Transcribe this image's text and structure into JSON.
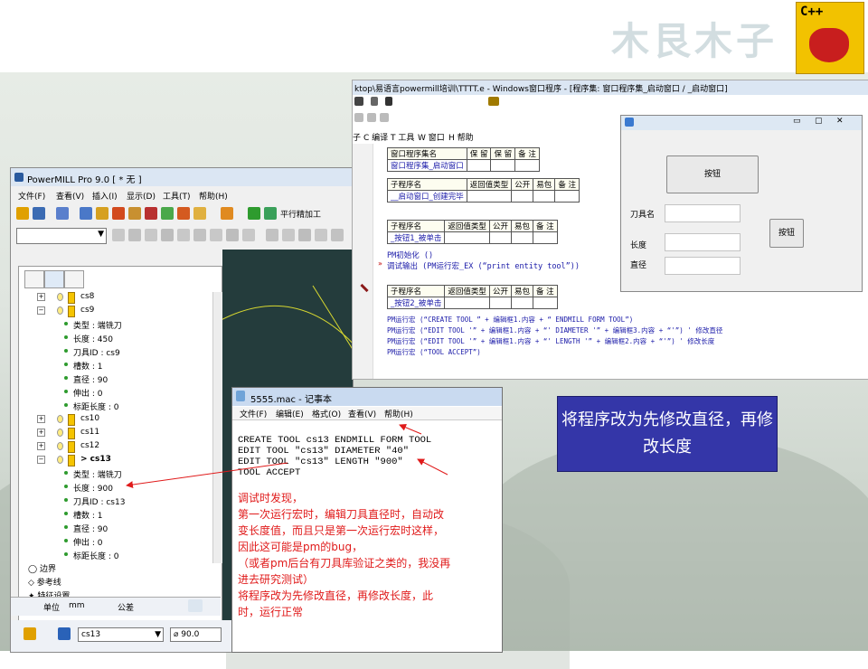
{
  "brand": {
    "watermark": "木艮木子",
    "logo_text": "C++"
  },
  "powermill": {
    "title": "PowerMILL Pro 9.0   [ * 无 ]",
    "menu": [
      "文件(F)",
      "查看(V)",
      "插入(I)",
      "显示(D)",
      "工具(T)",
      "帮助(H)"
    ],
    "toolbar_label": "平行精加工",
    "tree": {
      "collapsed_tools": [
        "cs8",
        "cs9"
      ],
      "cs9_props": [
        "类型 : 端铣刀",
        "长度 : 450",
        "刀具ID : cs9",
        "槽数 : 1",
        "直径 : 90",
        "伸出 : 0",
        "标距长度 : 0"
      ],
      "more_tools": [
        "cs10",
        "cs11",
        "cs12",
        "> cs13"
      ],
      "cs13_props": [
        "类型 : 端铣刀",
        "长度 : 900",
        "刀具ID : cs13",
        "槽数 : 1",
        "直径 : 90",
        "伸出 : 0",
        "标距长度 : 0"
      ],
      "nodes": [
        "边界",
        "参考线",
        "特征设置"
      ]
    },
    "status": {
      "unit_label": "单位",
      "unit_value": "mm",
      "tol_label": "公差"
    },
    "bottom": {
      "tool_select": "cs13",
      "diameter": "90.0"
    }
  },
  "notepad": {
    "title": "5555.mac - 记事本",
    "menu": [
      "文件(F)",
      "编辑(E)",
      "格式(O)",
      "查看(V)",
      "帮助(H)"
    ],
    "code": [
      "CREATE TOOL cs13 ENDMILL FORM TOOL",
      "EDIT TOOL \"cs13\" DIAMETER \"40\"",
      "EDIT TOOL \"cs13\" LENGTH \"900\"",
      "TOOL ACCEPT"
    ],
    "notes": [
      "调试时发现，",
      "第一次运行宏时，编辑刀具直径时，自动改",
      "变长度值，而且只是第一次运行宏时这样，",
      "因此这可能是pm的bug，",
      "（或者pm后台有刀具库验证之类的，我没再",
      "进去研究测试）",
      "将程序改为先修改直径，再修改长度，此",
      "时，运行正常"
    ]
  },
  "ide": {
    "title": "ktop\\易语言powermill培训\\TTTT.e - Windows窗口程序 - [程序集: 窗口程序集_启动窗口 / _启动窗口]",
    "menu": [
      "子",
      "C 编译",
      "T 工具",
      "W 窗口",
      "H 帮助"
    ],
    "table1": {
      "headers": [
        "窗口程序集名",
        "保 留",
        "保 留",
        "备 注"
      ],
      "row": "窗口程序集_启动窗口"
    },
    "table2": {
      "headers": [
        "子程序名",
        "返回值类型",
        "公开",
        "易包",
        "备 注"
      ],
      "row": "__启动窗口_创建完毕"
    },
    "table3": {
      "headers": [
        "子程序名",
        "返回值类型",
        "公开",
        "易包",
        "备 注"
      ],
      "row": "_按钮1_被单击"
    },
    "code3": [
      "PM初始化 ()",
      "调试输出 (PM运行宏_EX (“print entity tool”))"
    ],
    "table4": {
      "headers": [
        "子程序名",
        "返回值类型",
        "公开",
        "易包",
        "备 注"
      ],
      "row": "_按钮2_被单击"
    },
    "code4": [
      "PM运行宏 (“CREATE TOOL ” + 编辑框1.内容 + “ ENDMILL FORM TOOL”)",
      "PM运行宏 (“EDIT TOOL '” + 编辑框1.内容 + “' DIAMETER '” + 编辑框3.内容 + “'”)  ' 修改直径",
      "PM运行宏 (“EDIT TOOL '” + 编辑框1.内容 + “' LENGTH '” + 编辑框2.内容 + “'”)  ' 修改长度",
      "PM运行宏 (“TOOL ACCEPT”)"
    ],
    "form": {
      "button1": "按钮",
      "button2": "按钮",
      "labels": [
        "刀具名",
        "长度",
        "直径"
      ]
    }
  },
  "callout": {
    "text": "将程序改为先修改直径，再修改长度"
  }
}
